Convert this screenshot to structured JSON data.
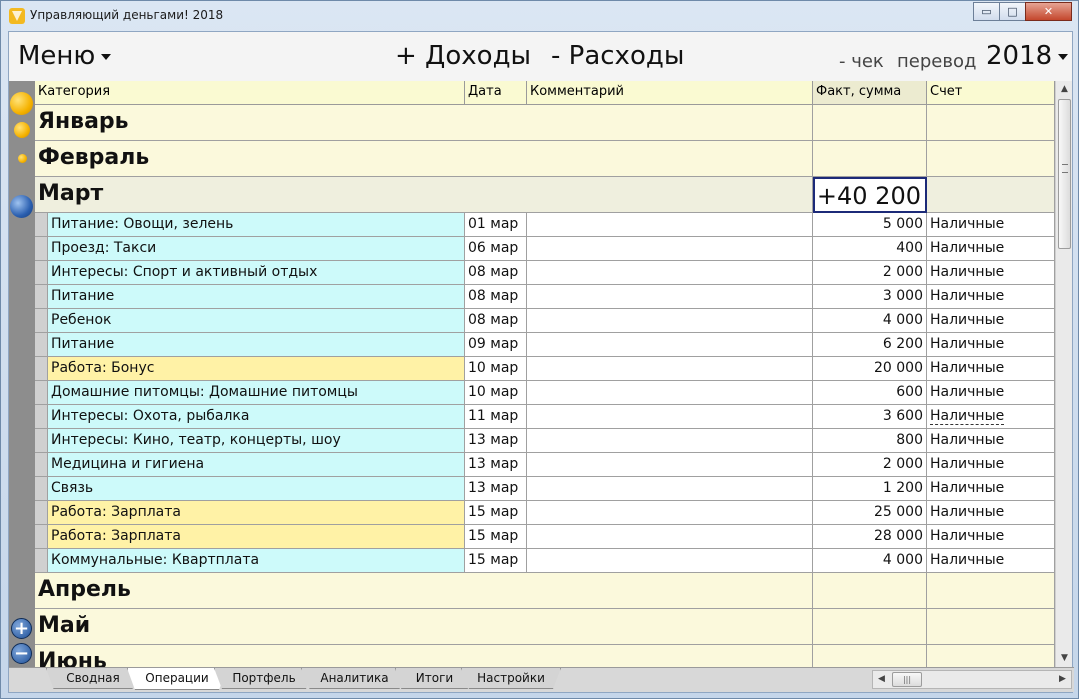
{
  "window": {
    "title": "Управляющий деньгами! 2018",
    "minimize": "▭",
    "maximize": "□",
    "close": "✕"
  },
  "toolbar": {
    "menu_label": "Меню",
    "income_label": "+ Доходы",
    "expense_label": "- Расходы",
    "check_label": "- чек",
    "transfer_label": "перевод",
    "year_label": "2018"
  },
  "columns": {
    "category": "Категория",
    "date": "Дата",
    "comment": "Комментарий",
    "amount": "Факт, сумма",
    "account": "Счет"
  },
  "months": {
    "jan": {
      "name": "Январь",
      "total": ""
    },
    "feb": {
      "name": "Февраль",
      "total": ""
    },
    "mar": {
      "name": "Март",
      "total": "+40 200"
    },
    "apr": {
      "name": "Апрель",
      "total": ""
    },
    "may": {
      "name": "Май",
      "total": ""
    },
    "jun": {
      "name": "Июнь",
      "total": ""
    }
  },
  "transactions": [
    {
      "category": "Питание: Овощи, зелень",
      "date": "01 мар",
      "comment": "",
      "amount": "5 000",
      "account": "Наличные"
    },
    {
      "category": "Проезд: Такси",
      "date": "06 мар",
      "comment": "",
      "amount": "400",
      "account": "Наличные"
    },
    {
      "category": "Интересы: Спорт и активный отдых",
      "date": "08 мар",
      "comment": "",
      "amount": "2 000",
      "account": "Наличные"
    },
    {
      "category": "Питание",
      "date": "08 мар",
      "comment": "",
      "amount": "3 000",
      "account": "Наличные"
    },
    {
      "category": "Ребенок",
      "date": "08 мар",
      "comment": "",
      "amount": "4 000",
      "account": "Наличные"
    },
    {
      "category": "Питание",
      "date": "09 мар",
      "comment": "",
      "amount": "6 200",
      "account": "Наличные"
    },
    {
      "category": "Работа: Бонус",
      "date": "10 мар",
      "comment": "",
      "amount": "20 000",
      "account": "Наличные"
    },
    {
      "category": "Домашние питомцы: Домашние питомцы",
      "date": "10 мар",
      "comment": "",
      "amount": "600",
      "account": "Наличные"
    },
    {
      "category": "Интересы: Охота, рыбалка",
      "date": "11 мар",
      "comment": "",
      "amount": "3 600",
      "account": "Наличные"
    },
    {
      "category": "Интересы: Кино, театр, концерты, шоу",
      "date": "13 мар",
      "comment": "",
      "amount": "800",
      "account": "Наличные"
    },
    {
      "category": "Медицина и гигиена",
      "date": "13 мар",
      "comment": "",
      "amount": "2 000",
      "account": "Наличные"
    },
    {
      "category": "Связь",
      "date": "13 мар",
      "comment": "",
      "amount": "1 200",
      "account": "Наличные"
    },
    {
      "category": "Работа: Зарплата",
      "date": "15 мар",
      "comment": "",
      "amount": "25 000",
      "account": "Наличные"
    },
    {
      "category": "Работа: Зарплата",
      "date": "15 мар",
      "comment": "",
      "amount": "28 000",
      "account": "Наличные"
    },
    {
      "category": "Коммунальные: Квартплата",
      "date": "15 мар",
      "comment": "",
      "amount": "4 000",
      "account": "Наличные"
    }
  ],
  "side_buttons": {
    "add": "+",
    "remove": "−"
  },
  "tabs": [
    "Сводная",
    "Операции",
    "Портфель",
    "Аналитика",
    "Итоги",
    "Настройки"
  ],
  "active_tab": "Операции",
  "scroll": {
    "up": "▲",
    "down": "▼",
    "left": "◀",
    "right": "▶",
    "grip": "|||"
  },
  "colors": {
    "income_row": "#fff2a6",
    "expense_row": "#cdfafa",
    "month_row": "#fbf9dc",
    "header_row": "#fafad2"
  }
}
